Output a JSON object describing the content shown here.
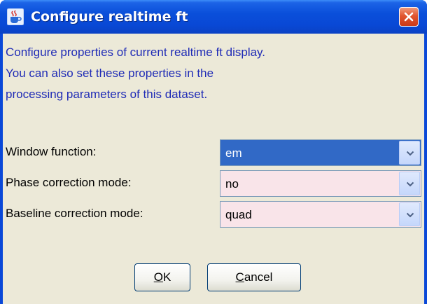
{
  "window": {
    "title": "Configure realtime ft",
    "app_icon": "java-cup-icon",
    "close_icon": "close-x-icon"
  },
  "description": {
    "lines": [
      "Configure properties of current realtime ft display.",
      "You can also set these properties in the",
      "processing parameters of this dataset."
    ]
  },
  "form": {
    "window_function": {
      "label": "Window function:",
      "value": "em"
    },
    "phase_correction": {
      "label": "Phase correction mode:",
      "value": "no"
    },
    "baseline_correction": {
      "label": "Baseline correction mode:",
      "value": "quad"
    }
  },
  "buttons": {
    "ok": {
      "mnemonic": "O",
      "rest": "K"
    },
    "cancel": {
      "mnemonic": "C",
      "rest": "ancel"
    }
  },
  "colors": {
    "titlebar": "#0a48d8",
    "description_text": "#1f2bb6",
    "selected_combo_bg": "#3169c6",
    "pink_combo_bg": "#f9e4e9"
  }
}
